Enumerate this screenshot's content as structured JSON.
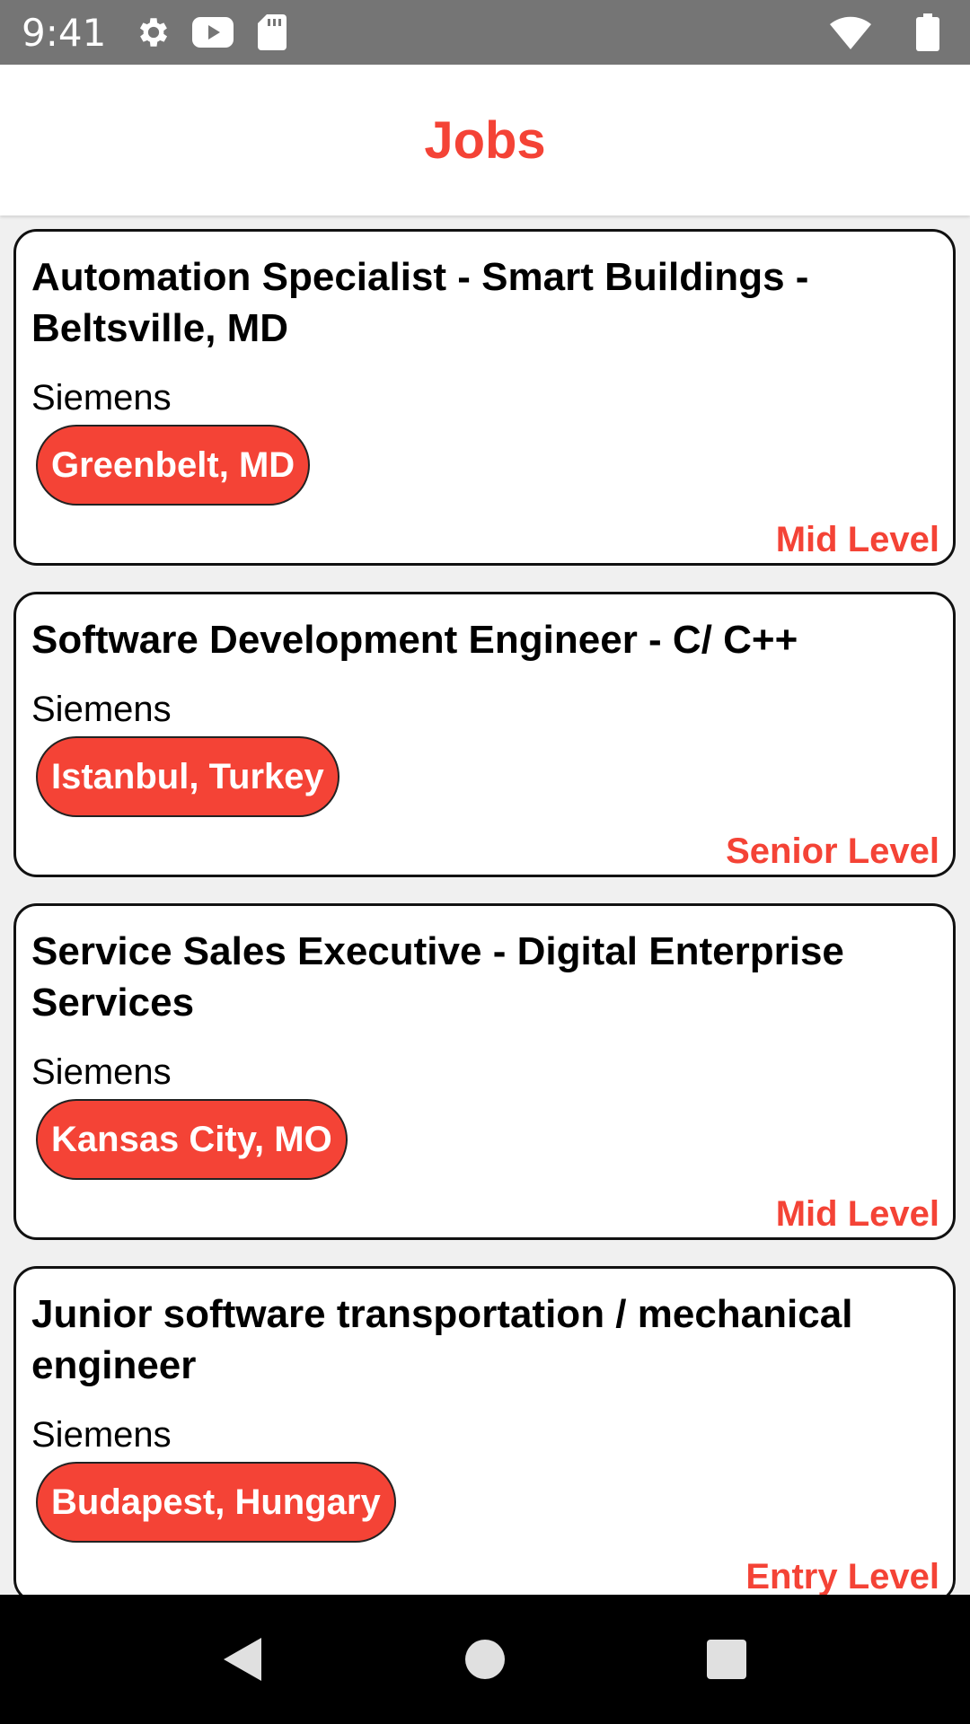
{
  "status_bar": {
    "time": "9:41",
    "icons_left": [
      "gear-icon",
      "youtube-icon",
      "sd-card-icon"
    ],
    "icons_right": [
      "wifi-icon",
      "battery-icon"
    ]
  },
  "app_bar": {
    "title": "Jobs"
  },
  "colors": {
    "accent": "#f44336",
    "status_bar": "#757575",
    "background": "#f0f0f0"
  },
  "jobs": [
    {
      "title": "Automation Specialist - Smart Buildings - Beltsville, MD",
      "company": "Siemens",
      "location": "Greenbelt, MD",
      "level": "Mid Level"
    },
    {
      "title": "Software Development Engineer - C/ C++",
      "company": "Siemens",
      "location": "Istanbul, Turkey",
      "level": "Senior Level"
    },
    {
      "title": "Service Sales Executive - Digital Enterprise Services",
      "company": "Siemens",
      "location": "Kansas City, MO",
      "level": "Mid Level"
    },
    {
      "title": "Junior software transportation / mechanical engineer",
      "company": "Siemens",
      "location": "Budapest, Hungary",
      "level": "Entry Level"
    }
  ],
  "nav_bar": {
    "buttons": [
      "back-icon",
      "home-icon",
      "recents-icon"
    ]
  }
}
